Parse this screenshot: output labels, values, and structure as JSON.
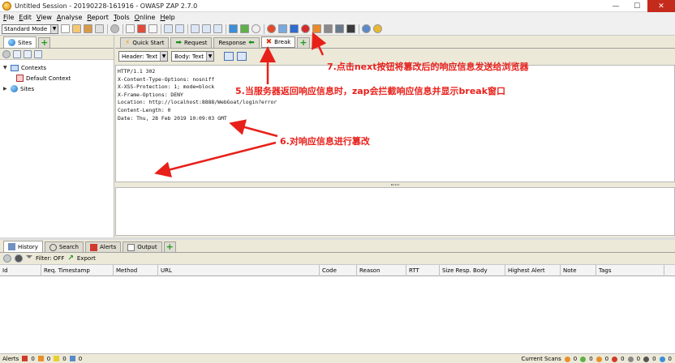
{
  "window": {
    "title": "Untitled Session - 20190228-161916 - OWASP ZAP 2.7.0",
    "controls": [
      "—",
      "☐",
      "✕"
    ]
  },
  "menu": [
    {
      "accel": "F",
      "rest": "ile"
    },
    {
      "accel": "E",
      "rest": "dit"
    },
    {
      "accel": "V",
      "rest": "iew"
    },
    {
      "accel": "A",
      "rest": "nalyse"
    },
    {
      "accel": "R",
      "rest": "eport"
    },
    {
      "accel": "T",
      "rest": "ools"
    },
    {
      "accel": "O",
      "rest": "nline"
    },
    {
      "accel": "H",
      "rest": "elp"
    }
  ],
  "toolbar": {
    "mode": "Standard Mode",
    "dropdown_arrow": "▼"
  },
  "sites": {
    "tab_label": "Sites",
    "tree": {
      "contexts": "Contexts",
      "default_context": "Default Context",
      "sites": "Sites",
      "expand_glyph": "▼",
      "collapse_glyph": "▶"
    }
  },
  "work_tabs": {
    "quick_start": "Quick Start",
    "request": "Request",
    "response": "Response",
    "break": "Break"
  },
  "break": {
    "header_view": "Header: Text",
    "body_view": "Body: Text",
    "response_header": "HTTP/1.1 302\nX-Content-Type-Options: nosniff\nX-XSS-Protection: 1; mode=block\nX-Frame-Options: DENY\nLocation: http://localhost:8888/WebGoat/login?error\nContent-Length: 0\nDate: Thu, 28 Feb 2019 10:09:03 GMT"
  },
  "bottom_tabs": {
    "history": "History",
    "search": "Search",
    "alerts": "Alerts",
    "output": "Output"
  },
  "history": {
    "filter": "Filter: OFF",
    "export": "Export",
    "columns": [
      "Id",
      "Req. Timestamp",
      "Method",
      "URL",
      "Code",
      "Reason",
      "RTT",
      "Size Resp. Body",
      "Highest Alert",
      "Note",
      "Tags"
    ]
  },
  "status": {
    "alerts_label": "Alerts",
    "alert_counts": [
      "0",
      "0",
      "0",
      "0"
    ],
    "current_scans_label": "Current Scans",
    "scan_counts": [
      "0",
      "0",
      "0",
      "0",
      "0",
      "0",
      "0"
    ]
  },
  "annotations": {
    "step5": "5.当服务器返回响应信息时，zap会拦截响应信息并显示break窗口",
    "step6": "6.对响应信息进行篡改",
    "step7": "7.点击next按钮将篡改后的响应信息发送给浏览器"
  },
  "colors": {
    "annotation": "#e8201a",
    "close_button": "#c42b1c",
    "add_tab_green": "#1e9c1e",
    "window_bg": "#ece9d8"
  }
}
